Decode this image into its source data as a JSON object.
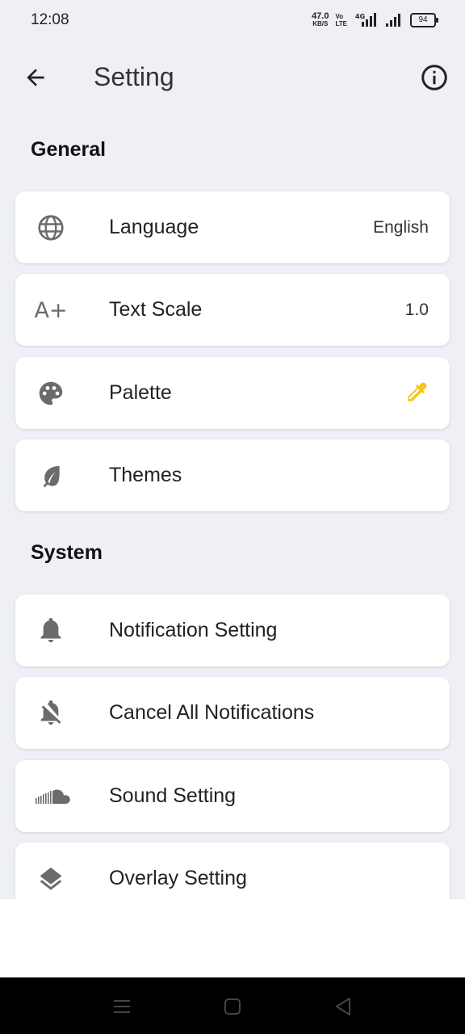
{
  "status_bar": {
    "time": "12:08",
    "net_speed": "47.0",
    "net_unit": "KB/S",
    "volte_top": "Vo",
    "volte_bottom": "LTE",
    "network": "4G",
    "battery": "94"
  },
  "app_bar": {
    "title": "Setting"
  },
  "general": {
    "title": "General",
    "items": [
      {
        "label": "Language",
        "value": "English",
        "icon": "globe-icon"
      },
      {
        "label": "Text Scale",
        "value": "1.0",
        "icon": "text-scale-icon"
      },
      {
        "label": "Palette",
        "icon": "palette-icon",
        "trailing_icon": "color-picker-icon"
      },
      {
        "label": "Themes",
        "icon": "leaf-icon"
      }
    ]
  },
  "system": {
    "title": "System",
    "items": [
      {
        "label": "Notification Setting",
        "icon": "bell-icon"
      },
      {
        "label": "Cancel All Notifications",
        "icon": "bell-off-icon"
      },
      {
        "label": "Sound Setting",
        "icon": "soundcloud-icon"
      },
      {
        "label": "Overlay Setting",
        "icon": "layers-icon"
      }
    ]
  },
  "colors": {
    "background": "#eef0f5",
    "card": "#ffffff",
    "icon_gray": "#6b6b6b",
    "accent_yellow": "#f5c518"
  },
  "icons": {
    "text_scale_glyph": "A+"
  },
  "nav_bar": {
    "buttons": [
      "menu-icon",
      "home-icon",
      "back-triangle-icon"
    ]
  }
}
